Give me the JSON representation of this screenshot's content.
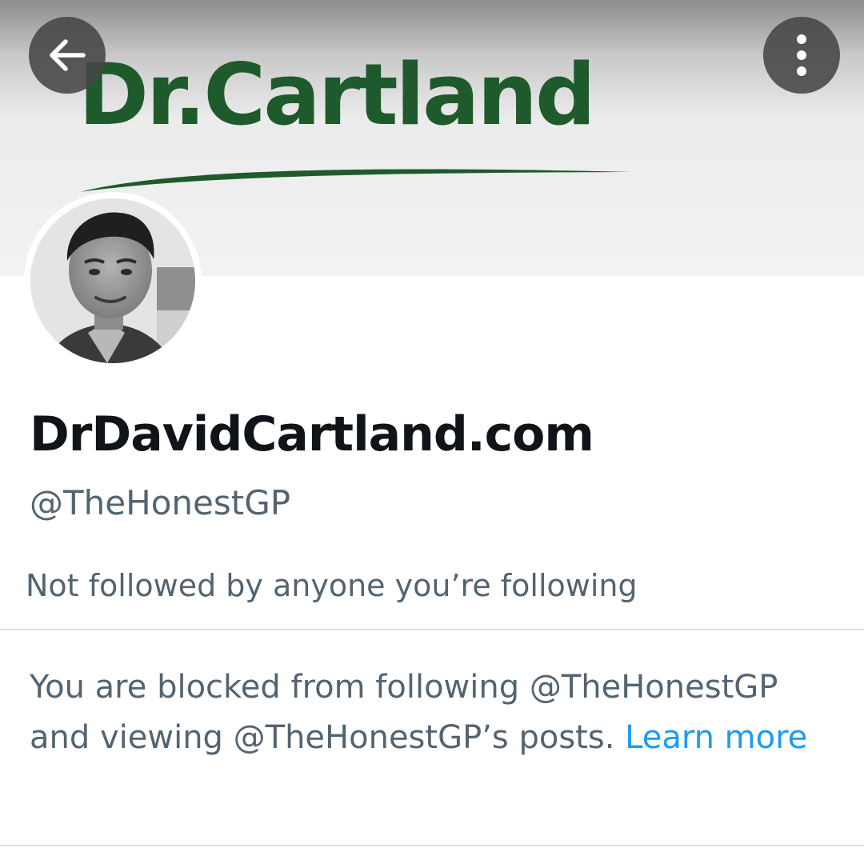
{
  "header": {
    "back_icon": "arrow-left-icon",
    "more_icon": "more-vertical-icon"
  },
  "banner": {
    "logo_text": "Dr.Cartland",
    "logo_color": "#1e5a2c"
  },
  "profile": {
    "display_name": "DrDavidCartland.com",
    "handle": "@TheHonestGP",
    "followers_note": "Not followed by anyone you’re following",
    "blocked_notice": "You are blocked from following @TheHonestGP and viewing @TheHonestGP’s posts.",
    "learn_more_label": "Learn more"
  },
  "colors": {
    "primary_text": "#0f1419",
    "secondary_text": "#536471",
    "link": "#1d9bf0",
    "divider": "#dadfe3"
  }
}
